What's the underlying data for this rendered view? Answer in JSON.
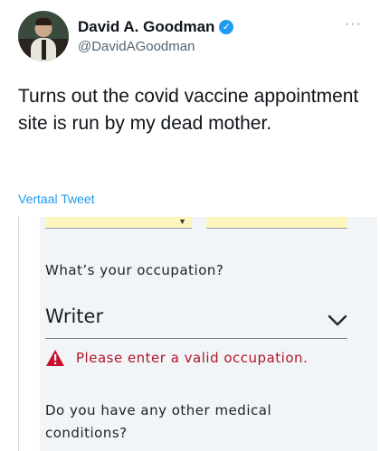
{
  "author": {
    "display_name": "David A. Goodman",
    "handle": "@DavidAGoodman"
  },
  "tweet": {
    "text": "Turns out the covid vaccine appointment site is run by my dead mother.",
    "translate_link": "Vertaal Tweet"
  },
  "icons": {
    "verified": "verified-badge-icon",
    "more": "more-options-icon",
    "warning": "warning-triangle-icon",
    "chevron": "chevron-down-icon"
  },
  "form": {
    "occupation_question": "What’s your occupation?",
    "occupation_value": "Writer",
    "error_message": "Please enter a valid occupation.",
    "medical_question": "Do you have any other medical conditions?"
  },
  "colors": {
    "link": "#1d9bf0",
    "error": "#b0152a",
    "highlight_field": "#fdf6bf"
  }
}
